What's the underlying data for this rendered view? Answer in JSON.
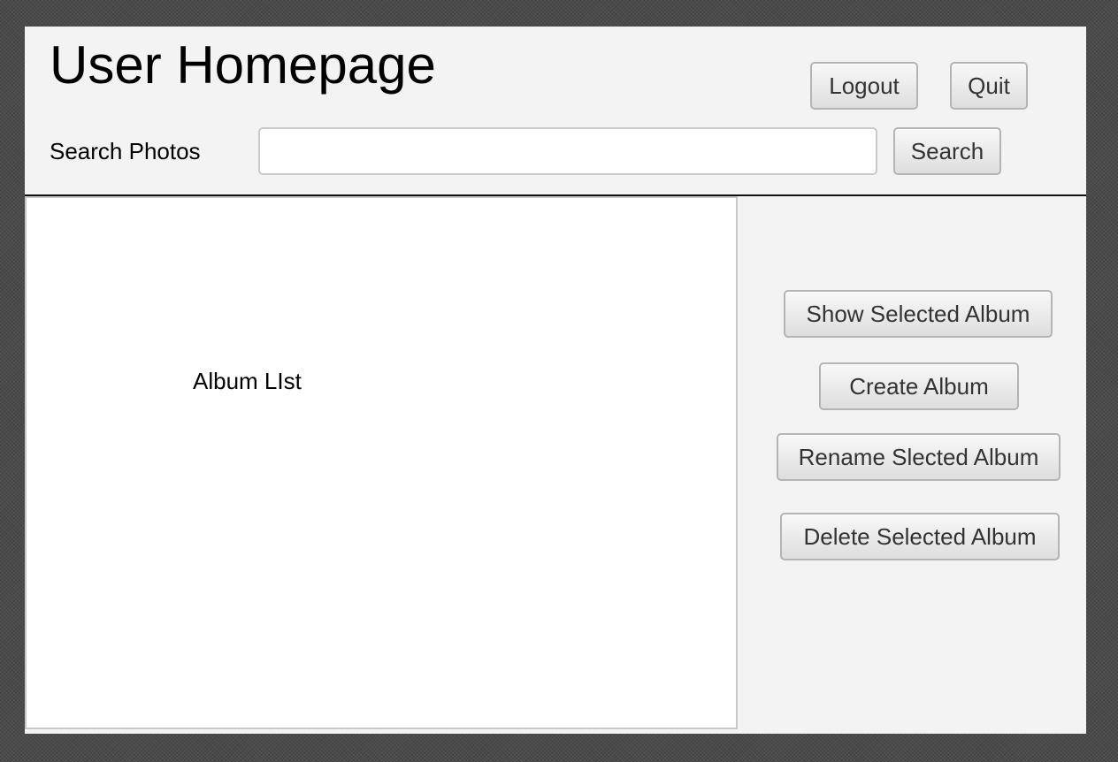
{
  "header": {
    "title": "User Homepage",
    "logout_label": "Logout",
    "quit_label": "Quit"
  },
  "search": {
    "label": "Search Photos",
    "value": "",
    "placeholder": "",
    "button_label": "Search"
  },
  "album_list": {
    "label": "Album LIst"
  },
  "actions": {
    "show_selected": "Show Selected Album",
    "create": "Create Album",
    "rename_selected": "Rename Slected Album",
    "delete_selected": "Delete Selected Album"
  },
  "colors": {
    "window_bg": "#f3f3f3",
    "list_bg": "#ffffff",
    "divider": "#111111",
    "button_text": "#333333"
  }
}
